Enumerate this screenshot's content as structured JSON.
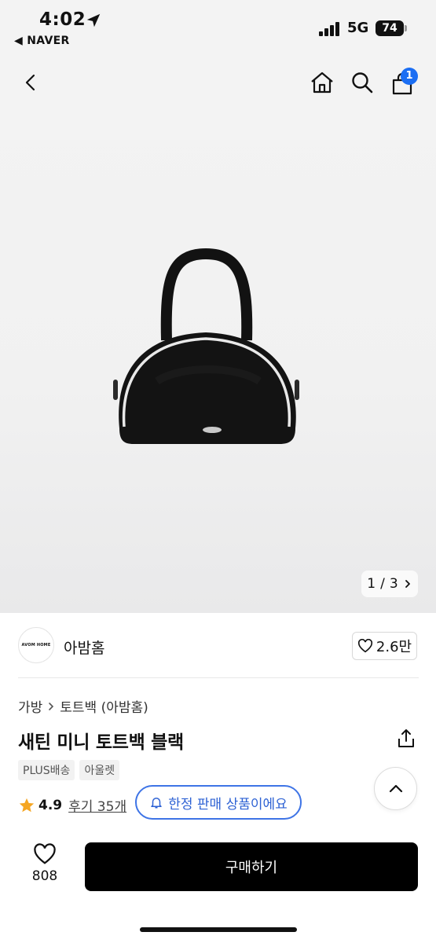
{
  "status_bar": {
    "time": "4:02",
    "back_app": "◀ NAVER",
    "network": "5G",
    "battery": "74"
  },
  "nav": {
    "cart_badge": "1"
  },
  "gallery": {
    "current": "1",
    "total": "3",
    "separator": "/"
  },
  "store": {
    "logo_text": "AVOM HOME",
    "name": "아밤홈",
    "likes": "2.6만"
  },
  "product": {
    "breadcrumb": [
      "가방",
      "토트백 (아밤홈)"
    ],
    "title": "새틴 미니 토트백 블랙",
    "tags": [
      "PLUS배송",
      "아울렛"
    ],
    "rating": "4.9",
    "reviews": "후기 35개",
    "limited_label": "한정 판매 상품이에요"
  },
  "bottom_bar": {
    "wish_count": "808",
    "buy_label": "구매하기"
  },
  "colors": {
    "accent_blue": "#3e74e6",
    "badge_blue": "#1b6ef3",
    "star": "#f5a623",
    "buy_button": "#000000"
  },
  "icons": [
    "location-arrow-icon",
    "back-arrow-icon",
    "home-icon",
    "search-icon",
    "cart-icon",
    "chevron-right-icon",
    "heart-icon",
    "share-icon",
    "star-icon",
    "bell-icon",
    "chevron-up-icon"
  ]
}
